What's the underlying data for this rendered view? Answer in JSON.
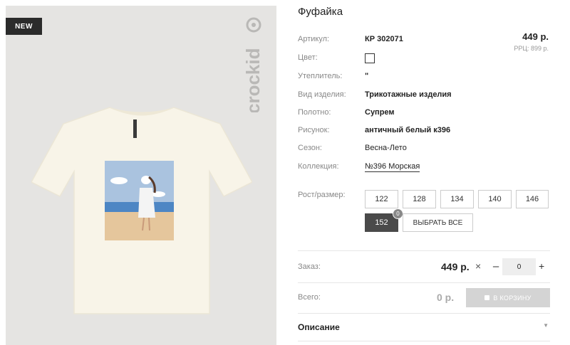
{
  "badge": "NEW",
  "brand": "crockid",
  "product": {
    "title": "Фуфайка",
    "price": "449 р.",
    "rrc": "РРЦ: 899 р."
  },
  "attributes": {
    "article_label": "Артикул:",
    "article_value": "КР 302071",
    "color_label": "Цвет:",
    "insulation_label": "Утеплитель:",
    "insulation_value": "\"",
    "type_label": "Вид изделия:",
    "type_value": "Трикотажные изделия",
    "fabric_label": "Полотно:",
    "fabric_value": "Супрем",
    "pattern_label": "Рисунок:",
    "pattern_value": "античный белый к396",
    "season_label": "Сезон:",
    "season_value": "Весна-Лето",
    "collection_label": "Коллекция:",
    "collection_value": "№396 Морская"
  },
  "sizes": {
    "label": "Рост/размер:",
    "options": [
      "122",
      "128",
      "134",
      "140",
      "146",
      "152"
    ],
    "selected": "152",
    "selected_count": "0",
    "select_all": "ВЫБРАТЬ ВСЕ"
  },
  "order": {
    "label": "Заказ:",
    "price": "449 р.",
    "times": "×",
    "minus": "–",
    "qty": "0",
    "plus": "+"
  },
  "total": {
    "label": "Всего:",
    "value": "0 р.",
    "cart_button": "В КОРЗИНУ"
  },
  "description": {
    "label": "Описание",
    "arrow": "▼"
  },
  "colors": {
    "dark": "#4a4a4a",
    "image_bg": "#e5e4e2",
    "shirt": "#f8f4e8",
    "cart_disabled": "#d4d4d4"
  }
}
